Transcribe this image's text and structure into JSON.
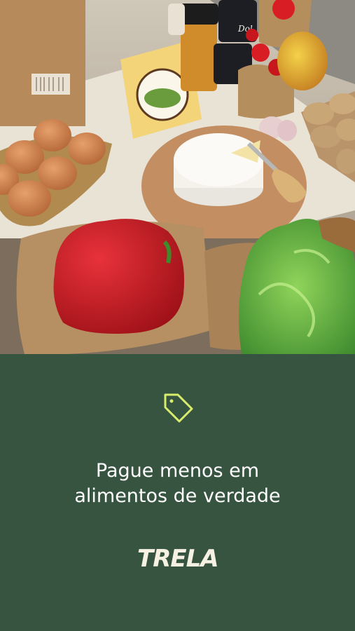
{
  "hero": {
    "image_label": "fresh-groceries-photo"
  },
  "promo": {
    "icon": "price-tag-icon",
    "headline_line1": "Pague menos em",
    "headline_line2": "alimentos de verdade"
  },
  "brand": {
    "logo_text": "TRELA"
  },
  "colors": {
    "background": "#36543f",
    "icon_accent": "#d9ec6c",
    "text": "#ffffff",
    "logo": "#f6f1e2"
  }
}
